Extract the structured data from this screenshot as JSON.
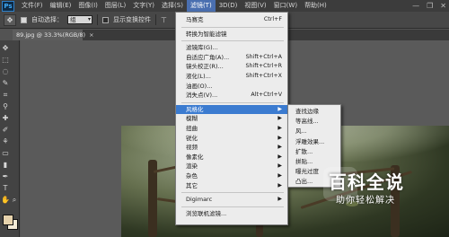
{
  "app": {
    "logo": "Ps"
  },
  "menubar": {
    "items": [
      "文件(F)",
      "编辑(E)",
      "图像(I)",
      "图层(L)",
      "文字(Y)",
      "选择(S)",
      "滤镜(T)",
      "3D(D)",
      "视图(V)",
      "窗口(W)",
      "帮助(H)"
    ],
    "active_index": 6,
    "window_controls": [
      "—",
      "❐",
      "✕"
    ]
  },
  "options_bar": {
    "auto_select_label": "自动选择：",
    "auto_select_value": "组",
    "show_transform_label": "显示变换控件"
  },
  "document": {
    "tab_title": "89.jpg @ 33.3%(RGB/8)",
    "tab_close": "×"
  },
  "filter_menu": {
    "rows": [
      {
        "label": "马赛克",
        "shortcut": "Ctrl+F"
      },
      {
        "sep": true
      },
      {
        "label": "转换为智能滤镜"
      },
      {
        "sep": true
      },
      {
        "label": "滤镜库(G)..."
      },
      {
        "label": "自适应广角(A)...",
        "shortcut": "Shift+Ctrl+A"
      },
      {
        "label": "镜头校正(R)...",
        "shortcut": "Shift+Ctrl+R"
      },
      {
        "label": "液化(L)...",
        "shortcut": "Shift+Ctrl+X"
      },
      {
        "label": "油画(O)..."
      },
      {
        "label": "消失点(V)...",
        "shortcut": "Alt+Ctrl+V"
      },
      {
        "sep": true
      },
      {
        "label": "风格化",
        "submenu": true,
        "highlighted": true
      },
      {
        "label": "模糊",
        "submenu": true
      },
      {
        "label": "扭曲",
        "submenu": true
      },
      {
        "label": "锐化",
        "submenu": true
      },
      {
        "label": "视频",
        "submenu": true
      },
      {
        "label": "像素化",
        "submenu": true
      },
      {
        "label": "渲染",
        "submenu": true
      },
      {
        "label": "杂色",
        "submenu": true
      },
      {
        "label": "其它",
        "submenu": true
      },
      {
        "sep": true
      },
      {
        "label": "Digimarc",
        "submenu": true
      },
      {
        "sep": true
      },
      {
        "label": "浏览联机滤镜..."
      }
    ],
    "submenu_arrow": "▶"
  },
  "stylize_submenu": {
    "items": [
      "查找边缘",
      "等高线...",
      "风...",
      "浮雕效果...",
      "扩散...",
      "拼贴...",
      "曝光过度",
      "凸出..."
    ]
  },
  "watermark": {
    "title": "百科全说",
    "subtitle": "助你轻松解决"
  },
  "colors": {
    "foreground": "#e6d2ac",
    "background": "#f2ead6",
    "menu_highlight": "#3b7bd0"
  }
}
